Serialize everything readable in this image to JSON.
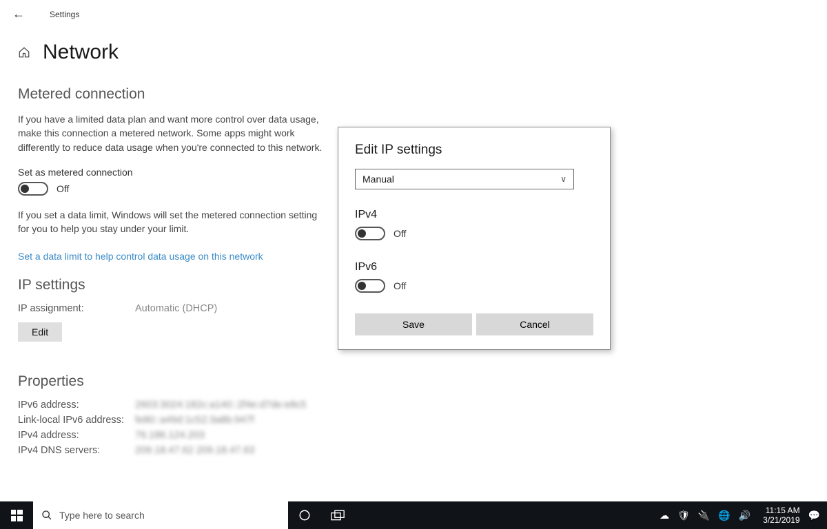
{
  "titlebar": {
    "app": "Settings"
  },
  "page": {
    "title": "Network"
  },
  "metered": {
    "heading": "Metered connection",
    "desc1": "If you have a limited data plan and want more control over data usage, make this connection a metered network. Some apps might work differently to reduce data usage when you're connected to this network.",
    "toggle_label": "Set as metered connection",
    "toggle_state": "Off",
    "desc2": "If you set a data limit, Windows will set the metered connection setting for you to help you stay under your limit.",
    "link": "Set a data limit to help control data usage on this network"
  },
  "ipsettings": {
    "heading": "IP settings",
    "assignment_label": "IP assignment:",
    "assignment_value": "Automatic (DHCP)",
    "edit_btn": "Edit"
  },
  "properties": {
    "heading": "Properties",
    "rows": [
      {
        "k": "IPv6 address:",
        "v": "2603:3024:182c:a140::2f4e:d7de:e8c5"
      },
      {
        "k": "Link-local IPv6 address:",
        "v": "fe80::a49d:1c52:3a8b:947f"
      },
      {
        "k": "IPv4 address:",
        "v": "76.186.124.203"
      },
      {
        "k": "IPv4 DNS servers:",
        "v": "209.18.47.62  209.18.47.63"
      }
    ]
  },
  "dialog": {
    "title": "Edit IP settings",
    "mode": "Manual",
    "ipv4_label": "IPv4",
    "ipv4_state": "Off",
    "ipv6_label": "IPv6",
    "ipv6_state": "Off",
    "save": "Save",
    "cancel": "Cancel"
  },
  "taskbar": {
    "search_placeholder": "Type here to search",
    "time": "11:15 AM",
    "date": "3/21/2019"
  }
}
